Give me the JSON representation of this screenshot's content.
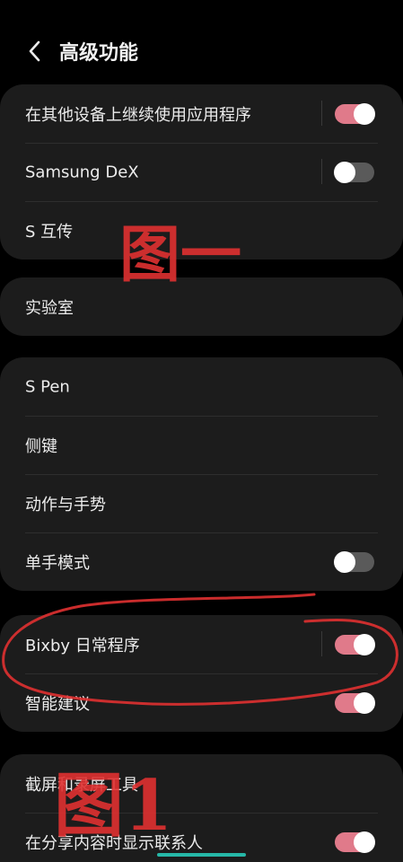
{
  "header": {
    "title": "高级功能",
    "back_icon": "chevron-left-icon"
  },
  "colors": {
    "toggle_on": "#e07a8a",
    "toggle_off": "#5a5a5a",
    "card_bg": "#1c1c1c",
    "annotation": "#e03131"
  },
  "groups": [
    {
      "items": [
        {
          "label": "在其他设备上继续使用应用程序",
          "toggle": "on"
        },
        {
          "label": "Samsung DeX",
          "toggle": "off"
        },
        {
          "label": "S 互传"
        }
      ]
    },
    {
      "items": [
        {
          "label": "实验室"
        }
      ]
    },
    {
      "items": [
        {
          "label": "S Pen"
        },
        {
          "label": "侧键"
        },
        {
          "label": "动作与手势"
        },
        {
          "label": "单手模式",
          "toggle": "off"
        }
      ]
    },
    {
      "items": [
        {
          "label": "Bixby 日常程序",
          "toggle": "on"
        },
        {
          "label": "智能建议",
          "toggle": "on"
        }
      ]
    },
    {
      "items": [
        {
          "label": "截屏和录屏工具"
        },
        {
          "label": "在分享内容时显示联系人",
          "toggle": "on"
        }
      ]
    }
  ],
  "annotations": {
    "label_1": "图一",
    "label_2": "图1"
  }
}
